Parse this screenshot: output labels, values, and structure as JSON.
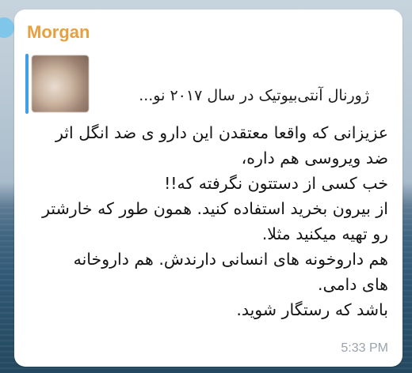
{
  "message": {
    "sender": "Morgan",
    "reply_preview": {
      "text": "ژورنال آنتی‌بیوتیک در سال ۲۰۱۷ نو..."
    },
    "lines": [
      "عزیزانی که واقعا معتقدن این دارو ی ضد انگل اثر",
      "ضد ویروسی هم داره،",
      "خب کسی از دستتون نگرفته که!!",
      "از بیرون بخرید استفاده کنید. همون طور که خارشتر",
      "رو تهیه میکنید مثلا.",
      "هم داروخونه های انسانی دارندش. هم داروخانه",
      "های دامی.",
      "باشد که رستگار شوید."
    ],
    "time": "5:33 PM"
  },
  "colors": {
    "sender": "#e6a040",
    "reply_bar": "#3fa0e8",
    "time": "#9aa3ab",
    "bubble": "#ffffff"
  }
}
